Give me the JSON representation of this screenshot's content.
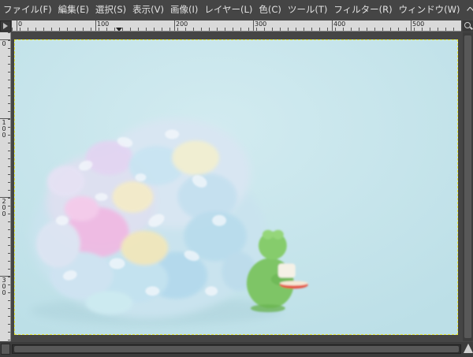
{
  "menu": [
    {
      "label": "ファイル(F)",
      "name": "menu-file"
    },
    {
      "label": "編集(E)",
      "name": "menu-edit"
    },
    {
      "label": "選択(S)",
      "name": "menu-select"
    },
    {
      "label": "表示(V)",
      "name": "menu-view"
    },
    {
      "label": "画像(I)",
      "name": "menu-image"
    },
    {
      "label": "レイヤー(L)",
      "name": "menu-layer"
    },
    {
      "label": "色(C)",
      "name": "menu-color"
    },
    {
      "label": "ツール(T)",
      "name": "menu-tools"
    },
    {
      "label": "フィルター(R)",
      "name": "menu-filters"
    },
    {
      "label": "ウィンドウ(W)",
      "name": "menu-windows"
    },
    {
      "label": "ヘルプ(H)",
      "name": "menu-help"
    }
  ],
  "ruler": {
    "horizontal_labels": [
      "0",
      "100",
      "200",
      "300",
      "400",
      "500"
    ],
    "vertical_labels": [
      [
        "0"
      ],
      [
        "1",
        "0",
        "0"
      ],
      [
        "2",
        "0",
        "0"
      ],
      [
        "3",
        "0",
        "0"
      ]
    ]
  },
  "icons": {
    "ruler_corner": "triangle-right-icon",
    "zoom": "magnifier-icon",
    "navigate": "navigate-icon",
    "nav_arrow": "triangle-up-icon"
  },
  "colors": {
    "selection_border": "#e8e83a",
    "background": "#cfe9ef"
  }
}
